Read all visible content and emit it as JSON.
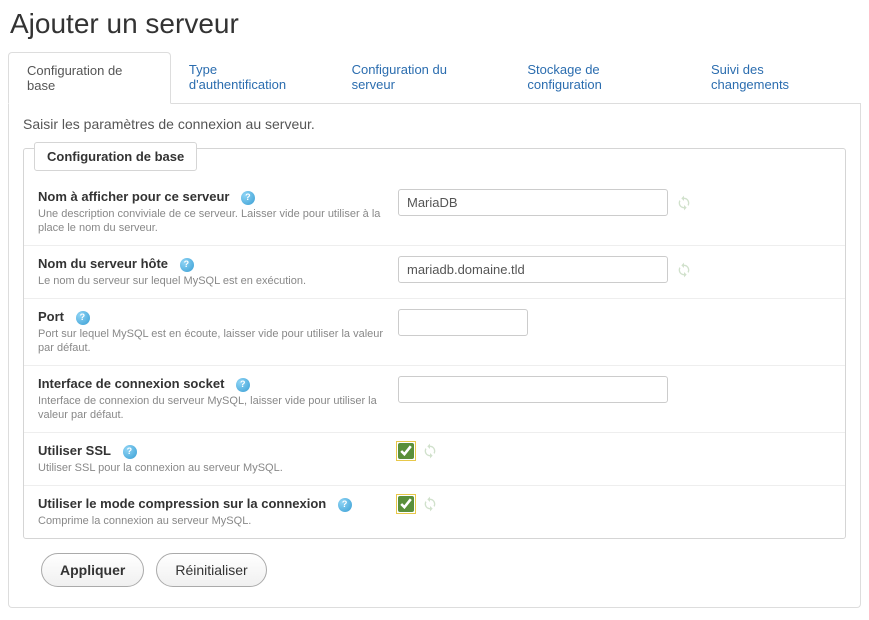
{
  "title": "Ajouter un serveur",
  "tabs": [
    {
      "label": "Configuration de base",
      "active": true
    },
    {
      "label": "Type d'authentification",
      "active": false
    },
    {
      "label": "Configuration du serveur",
      "active": false
    },
    {
      "label": "Stockage de configuration",
      "active": false
    },
    {
      "label": "Suivi des changements",
      "active": false
    }
  ],
  "intro": "Saisir les paramètres de connexion au serveur.",
  "fieldset_legend": "Configuration de base",
  "fields": {
    "display_name": {
      "label": "Nom à afficher pour ce serveur",
      "desc": "Une description conviviale de ce serveur. Laisser vide pour utiliser à la place le nom du serveur.",
      "value": "MariaDB"
    },
    "hostname": {
      "label": "Nom du serveur hôte",
      "desc": "Le nom du serveur sur lequel MySQL est en exécution.",
      "value": "mariadb.domaine.tld"
    },
    "port": {
      "label": "Port",
      "desc": "Port sur lequel MySQL est en écoute, laisser vide pour utiliser la valeur par défaut.",
      "value": ""
    },
    "socket": {
      "label": "Interface de connexion socket",
      "desc": "Interface de connexion du serveur MySQL, laisser vide pour utiliser la valeur par défaut.",
      "value": ""
    },
    "ssl": {
      "label": "Utiliser SSL",
      "desc": "Utiliser SSL pour la connexion au serveur MySQL.",
      "checked": true
    },
    "compress": {
      "label": "Utiliser le mode compression sur la connexion",
      "desc": "Comprime la connexion au serveur MySQL.",
      "checked": true
    }
  },
  "buttons": {
    "apply": "Appliquer",
    "reset": "Réinitialiser"
  }
}
